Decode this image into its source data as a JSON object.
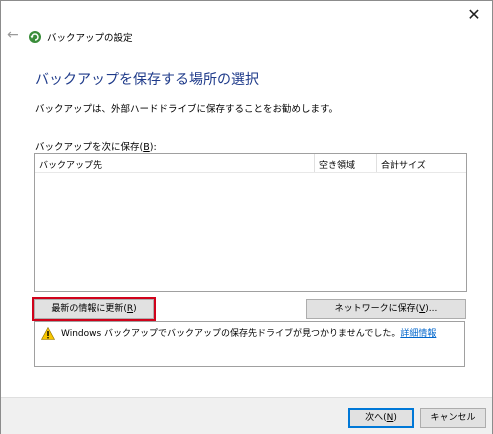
{
  "window": {
    "title": "バックアップの設定",
    "close_glyph": "✕",
    "back_glyph": "←"
  },
  "page": {
    "heading": "バックアップを保存する場所の選択",
    "description": "バックアップは、外部ハードドライブに保存することをお勧めします。",
    "save_to_label_prefix": "バックアップを次に保存(",
    "save_to_label_key": "B",
    "save_to_label_suffix": "):"
  },
  "table": {
    "columns": [
      "バックアップ先",
      "空き領域",
      "合計サイズ"
    ],
    "rows": []
  },
  "buttons": {
    "refresh_prefix": "最新の情報に更新(",
    "refresh_key": "R",
    "refresh_suffix": ")",
    "network_prefix": "ネットワークに保存(",
    "network_key": "V",
    "network_suffix": ")...",
    "next_prefix": "次へ(",
    "next_key": "N",
    "next_suffix": ")",
    "cancel": "キャンセル"
  },
  "warning": {
    "message": "Windows バックアップでバックアップの保存先ドライブが見つかりませんでした。",
    "link": "詳細情報"
  },
  "colors": {
    "heading": "#1e3a8a",
    "highlight": "#d0021b",
    "link": "#0066cc",
    "default_button_border": "#0078d7"
  }
}
